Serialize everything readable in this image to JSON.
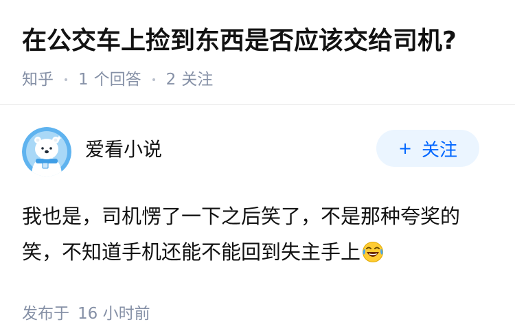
{
  "question": {
    "title": "在公交车上捡到东西是否应该交给司机?",
    "meta": {
      "source": "知乎",
      "answers_count": "1",
      "answers_label": "个回答",
      "followers_count": "2",
      "followers_label": "关注"
    }
  },
  "answer": {
    "author": {
      "name": "爱看小说",
      "avatar_icon": "bear-avatar-icon"
    },
    "follow_button": {
      "label": "关注",
      "icon": "plus-icon"
    },
    "content_line1": "我也是，司机愣了一下之后笑了，不是那种夸奖的",
    "content_line2": "笑，不知道手机还能不能回到失主手上",
    "content_emoji": "laughing-tears-emoji",
    "time": {
      "prefix": "发布于",
      "value": "16 小时前"
    }
  },
  "colors": {
    "meta_gray": "#8590a6",
    "follow_blue": "#0066ff",
    "follow_bg": "#ebf5ff",
    "avatar_blue": "#5fb3ef"
  }
}
